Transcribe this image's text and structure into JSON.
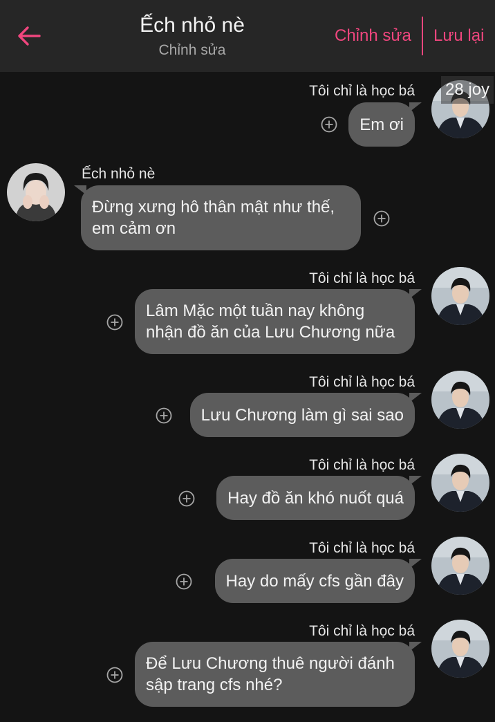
{
  "header": {
    "title": "Ếch nhỏ nè",
    "subtitle": "Chỉnh sửa",
    "edit_label": "Chỉnh sửa",
    "save_label": "Lưu lại"
  },
  "badge": "28 joy",
  "colors": {
    "accent": "#f0467e",
    "header_bg": "#262626",
    "chat_bg": "#141414",
    "bubble_bg": "#5c5c5c"
  },
  "messages": [
    {
      "side": "me",
      "name": "Tôi chỉ là học bá",
      "text": "Em ơi"
    },
    {
      "side": "other",
      "name": "Ếch nhỏ nè",
      "text": "Đừng xưng hô thân mật như thế, em cảm ơn"
    },
    {
      "side": "me",
      "name": "Tôi chỉ là học bá",
      "text": "Lâm Mặc một tuần nay không nhận đồ ăn của Lưu Chương nữa"
    },
    {
      "side": "me",
      "name": "Tôi chỉ là học bá",
      "text": "Lưu Chương làm gì sai sao"
    },
    {
      "side": "me",
      "name": "Tôi chỉ là học bá",
      "text": "Hay đồ ăn khó nuốt quá"
    },
    {
      "side": "me",
      "name": "Tôi chỉ là học bá",
      "text": "Hay do mấy cfs gần đây"
    },
    {
      "side": "me",
      "name": "Tôi chỉ là học bá",
      "text": "Để Lưu Chương thuê người đánh sập trang cfs nhé?"
    }
  ]
}
